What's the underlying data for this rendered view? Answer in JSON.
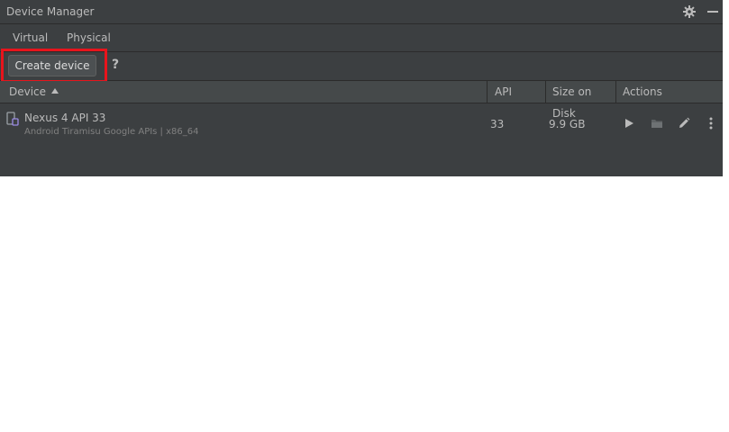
{
  "window": {
    "title": "Device Manager",
    "gear_icon": "gear-icon",
    "minimize_icon": "minimize-icon"
  },
  "tabs": [
    {
      "label": "Virtual",
      "active": true
    },
    {
      "label": "Physical",
      "active": false
    }
  ],
  "toolbar": {
    "create_label": "Create device",
    "help_label": "?"
  },
  "table": {
    "columns": [
      "Device",
      "API",
      "Size on Disk",
      "Actions"
    ],
    "sort_column": "Device",
    "sort_direction": "ascending",
    "rows": [
      {
        "name": "Nexus 4 API 33",
        "details": "Android Tiramisu Google APIs | x86_64",
        "api": "33",
        "size": "9.9 GB",
        "actions": [
          "play-icon",
          "folder-icon",
          "pencil-icon",
          "more-vertical-icon"
        ]
      }
    ]
  },
  "colors": {
    "panel_bg": "#3c3f41",
    "header_bg": "#45494a",
    "text": "#bbbbbb",
    "muted_text": "#808080",
    "highlight": "#e8141c",
    "device_icon": "#9b8ce6"
  }
}
